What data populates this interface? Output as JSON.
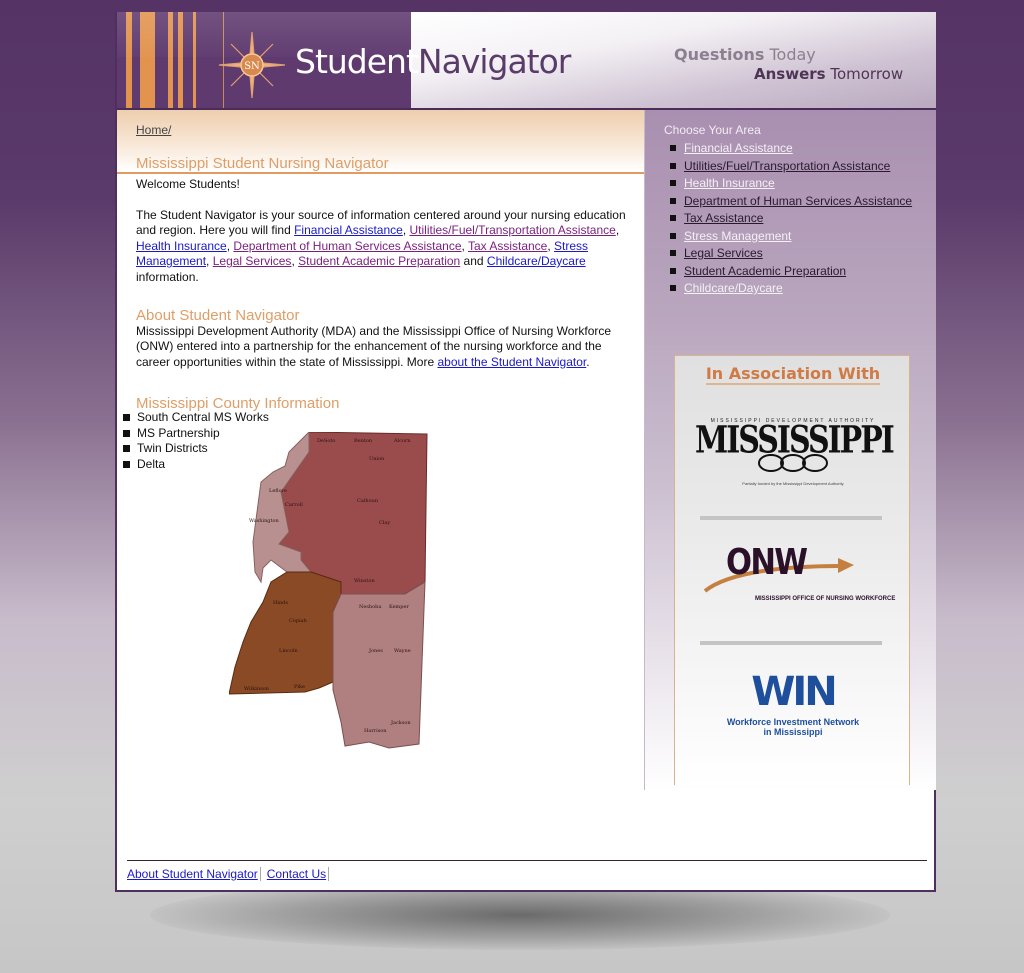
{
  "header": {
    "brand_part1": "Student",
    "brand_part2": "Navigator",
    "logo_mark": "SN",
    "tagline_line1_bold": "Questions",
    "tagline_line1_rest": " Today",
    "tagline_line2_bold": "Answers",
    "tagline_line2_rest": " Tomorrow"
  },
  "breadcrumb": {
    "home": "Home/"
  },
  "main": {
    "title": "Mississippi Student Nursing Navigator",
    "welcome": "Welcome Students!",
    "intro_prefix": "The Student Navigator is your source of information centered around your nursing education and region. Here you will find ",
    "intro_links": [
      "Financial Assistance",
      "Utilities/Fuel/Transportation Assistance",
      "Health Insurance",
      "Department of Human Services Assistance",
      "Tax Assistance",
      "Stress Management",
      "Legal Services",
      "Student Academic Preparation",
      "Childcare/Daycare"
    ],
    "sep_comma": ", ",
    "sep_and": " and ",
    "intro_suffix": "information.",
    "about_heading": "About Student Navigator",
    "about_text": "Mississippi Development Authority (MDA) and the Mississippi Office of Nursing Workforce (ONW) entered into a partnership for the enhancement of the nursing workforce and the career opportunities within the state of Mississippi. More ",
    "about_link": "about the Student Navigator",
    "about_end": ".",
    "county_heading": "Mississippi County Information",
    "county_items": [
      "South Central MS Works",
      "MS Partnership",
      "Twin Districts",
      "Delta"
    ],
    "map_region_colors": {
      "northeast": "#9a4c4c",
      "delta": "#b89090",
      "southwest": "#8a4a26",
      "southeast": "#b08080"
    }
  },
  "sidebar": {
    "title": "Choose Your Area",
    "items": [
      {
        "label": "Financial Assistance",
        "style": "light"
      },
      {
        "label": "Utilities/Fuel/Transportation Assistance",
        "style": "dark"
      },
      {
        "label": "Health Insurance",
        "style": "light"
      },
      {
        "label": "Department of Human Services Assistance",
        "style": "dark"
      },
      {
        "label": "Tax Assistance",
        "style": "dark"
      },
      {
        "label": "Stress Management",
        "style": "light"
      },
      {
        "label": "Legal Services",
        "style": "dark"
      },
      {
        "label": "Student Academic Preparation",
        "style": "dark"
      },
      {
        "label": "Childcare/Daycare",
        "style": "light"
      }
    ],
    "assoc_title": "In Association With",
    "partners": {
      "mda_top": "MISSISSIPPI DEVELOPMENT AUTHORITY",
      "mda_name": "MISSISSIPPI",
      "mda_sub": "Partially funded by the Mississippi Development Authority",
      "onw_name": "ONW",
      "onw_sub": "MISSISSIPPI OFFICE OF NURSING WORKFORCE",
      "win_name": "WIN",
      "win_sub1": "Workforce Investment Network",
      "win_sub2": "in Mississippi"
    }
  },
  "footer": {
    "links": [
      "About Student Navigator",
      "Contact Us"
    ]
  }
}
